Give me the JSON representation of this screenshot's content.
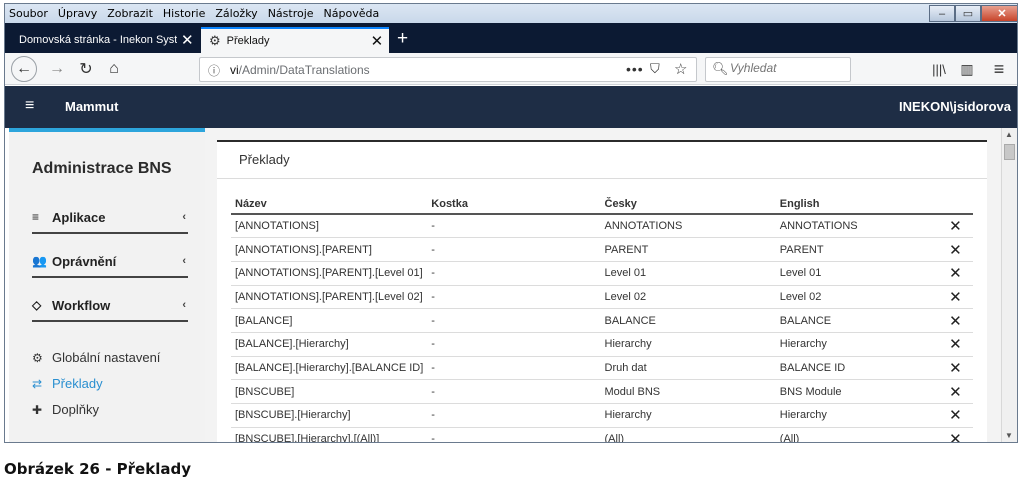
{
  "menubar": {
    "items": [
      "Soubor",
      "Úpravy",
      "Zobrazit",
      "Historie",
      "Záložky",
      "Nástroje",
      "Nápověda"
    ]
  },
  "window_controls": {
    "minimize": "–",
    "maximize": "▭",
    "close": "✕"
  },
  "tabs": [
    {
      "label": "Domovská stránka - Inekon Systems",
      "close": "✕"
    },
    {
      "label": "Překlady",
      "close": "✕"
    }
  ],
  "new_tab": "+",
  "nav": {
    "back": "←",
    "forward": "→",
    "reload": "↻",
    "home": "⌂",
    "url_prefix": "vi",
    "url_path": "/Admin/DataTranslations",
    "page_actions": "•••",
    "search_placeholder": "Vyhledat",
    "library": "|||\\",
    "sidebar_toggle": "▥",
    "menu": "≡"
  },
  "app": {
    "name": "Mammut",
    "user": "INEKON\\jsidorova",
    "menu_icon": "≡"
  },
  "sidebar": {
    "title": "Administrace BNS",
    "groups": [
      {
        "label": "Aplikace",
        "icon": "≡",
        "chevron": "‹"
      },
      {
        "label": "Oprávnění",
        "icon": "👥",
        "chevron": "‹"
      },
      {
        "label": "Workflow",
        "icon": "◇",
        "chevron": "‹"
      }
    ],
    "links": [
      {
        "label": "Globální nastavení",
        "icon": "⚙"
      },
      {
        "label": "Překlady",
        "icon": "⇄"
      },
      {
        "label": "Doplňky",
        "icon": "✚"
      }
    ]
  },
  "panel": {
    "title": "Překlady",
    "columns": [
      "Název",
      "Kostka",
      "Česky",
      "English"
    ],
    "delete_icon": "✕",
    "rows": [
      [
        "[ANNOTATIONS]",
        "-",
        "ANNOTATIONS",
        "ANNOTATIONS"
      ],
      [
        "[ANNOTATIONS].[PARENT]",
        "-",
        "PARENT",
        "PARENT"
      ],
      [
        "[ANNOTATIONS].[PARENT].[Level 01]",
        "-",
        "Level 01",
        "Level 01"
      ],
      [
        "[ANNOTATIONS].[PARENT].[Level 02]",
        "-",
        "Level 02",
        "Level 02"
      ],
      [
        "[BALANCE]",
        "-",
        "BALANCE",
        "BALANCE"
      ],
      [
        "[BALANCE].[Hierarchy]",
        "-",
        "Hierarchy",
        "Hierarchy"
      ],
      [
        "[BALANCE].[Hierarchy].[BALANCE ID]",
        "-",
        "Druh dat",
        "BALANCE ID"
      ],
      [
        "[BNSCUBE]",
        "-",
        "Modul BNS",
        "BNS Module"
      ],
      [
        "[BNSCUBE].[Hierarchy]",
        "-",
        "Hierarchy",
        "Hierarchy"
      ],
      [
        "[BNSCUBE].[Hierarchy].[(All)]",
        "-",
        "(All)",
        "(All)"
      ]
    ]
  },
  "caption": "Obrázek 26 - Překlady"
}
